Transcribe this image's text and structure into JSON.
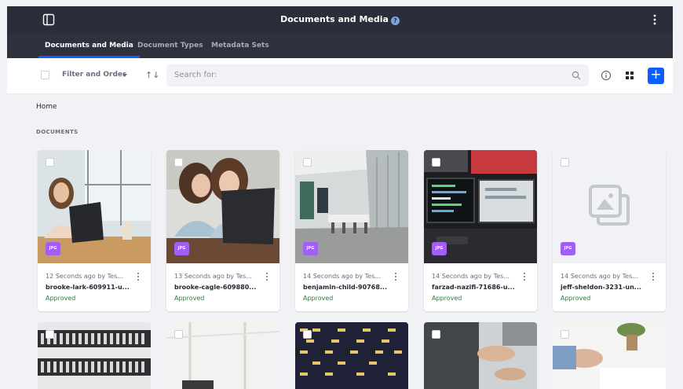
{
  "header": {
    "title": "Documents and Media"
  },
  "nav": {
    "tabs": [
      "Documents and Media",
      "Document Types",
      "Metadata Sets"
    ]
  },
  "toolbar": {
    "filter_label": "Filter and Order",
    "sort_glyph": "↑↓",
    "search_placeholder": "Search for:",
    "add_label": "+"
  },
  "breadcrumb": "Home",
  "section_label": "DOCUMENTS",
  "cards": [
    {
      "meta": "12 Seconds ago by Tes...",
      "name": "brooke-lark-609911-u...",
      "status": "Approved",
      "badge": "JPG"
    },
    {
      "meta": "13 Seconds ago by Tes...",
      "name": "brooke-cagle-609880...",
      "status": "Approved",
      "badge": "JPG"
    },
    {
      "meta": "14 Seconds ago by Tes...",
      "name": "benjamin-child-90768...",
      "status": "Approved",
      "badge": "JPG"
    },
    {
      "meta": "14 Seconds ago by Tes...",
      "name": "farzad-nazifi-71686-u...",
      "status": "Approved",
      "badge": "JPG"
    },
    {
      "meta": "14 Seconds ago by Tes...",
      "name": "jeff-sheldon-3231-un...",
      "status": "Approved",
      "badge": "JPG"
    }
  ],
  "colors": {
    "topbar": "#2c2d3a",
    "accent": "#0b5fff",
    "badge": "#a15ff5",
    "approved": "#287d3c"
  }
}
